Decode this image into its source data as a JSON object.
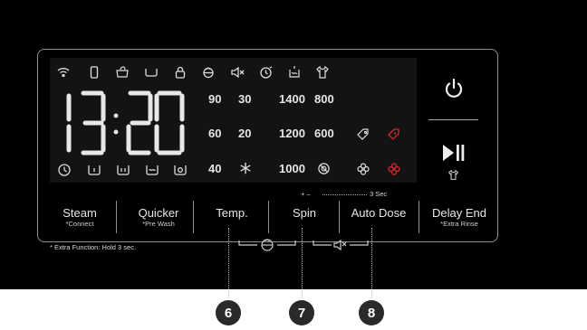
{
  "display": {
    "time": "13:20",
    "temperatures": [
      "90",
      "60",
      "40"
    ],
    "temps_low": [
      "30",
      "20"
    ],
    "spin_speeds_left": [
      "1400",
      "1200",
      "1000"
    ],
    "spin_speeds_right": [
      "800",
      "600"
    ]
  },
  "buttons": [
    {
      "label": "Steam",
      "sub": "*Connect"
    },
    {
      "label": "Quicker",
      "sub": "*Pre Wash"
    },
    {
      "label": "Temp.",
      "sub": ""
    },
    {
      "label": "Spin",
      "sub": ""
    },
    {
      "label": "Auto Dose",
      "sub": ""
    },
    {
      "label": "Delay End",
      "sub": "*Extra Rinse"
    }
  ],
  "hold_hint": {
    "prefix": "+ –",
    "suffix": "3 Sec"
  },
  "footnote": "* Extra Function: Hold 3 sec.",
  "callouts": [
    "6",
    "7",
    "8"
  ],
  "colors": {
    "panel": "#000000",
    "display": "#131313",
    "warning": "#d12b2b",
    "text": "#e6e6e6"
  },
  "icons": [
    "wifi-icon",
    "phone-icon",
    "eco-icon",
    "tub-icon",
    "lock-icon",
    "child-lock-icon",
    "mute-icon",
    "timer-icon",
    "softener-icon",
    "shirt-icon",
    "clock-icon",
    "power-icon",
    "play-pause-icon"
  ]
}
